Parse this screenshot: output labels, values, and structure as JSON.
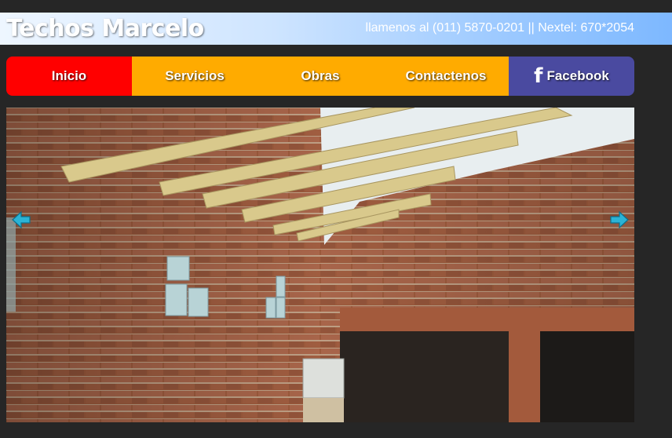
{
  "header": {
    "logo_text": "Techos Marcelo",
    "phone_text": "llamenos al (011) 5870-0201 || Nextel: 670*2054"
  },
  "nav": {
    "items": [
      {
        "label": "Inicio",
        "color": "#ff0000"
      },
      {
        "label": "Servicios",
        "color": "#ffab00"
      },
      {
        "label": "Obras",
        "color": "#ffab00"
      },
      {
        "label": "Contactenos",
        "color": "#ffab00"
      },
      {
        "label": "Facebook",
        "icon": "facebook-icon",
        "color": "#4a4aa0"
      }
    ]
  },
  "slider": {
    "prev_icon": "arrow-left-icon",
    "next_icon": "arrow-right-icon",
    "arrow_color": "#2bb3d6"
  },
  "colors": {
    "background": "#262626",
    "header_gradient_end": "#7db8ff"
  }
}
